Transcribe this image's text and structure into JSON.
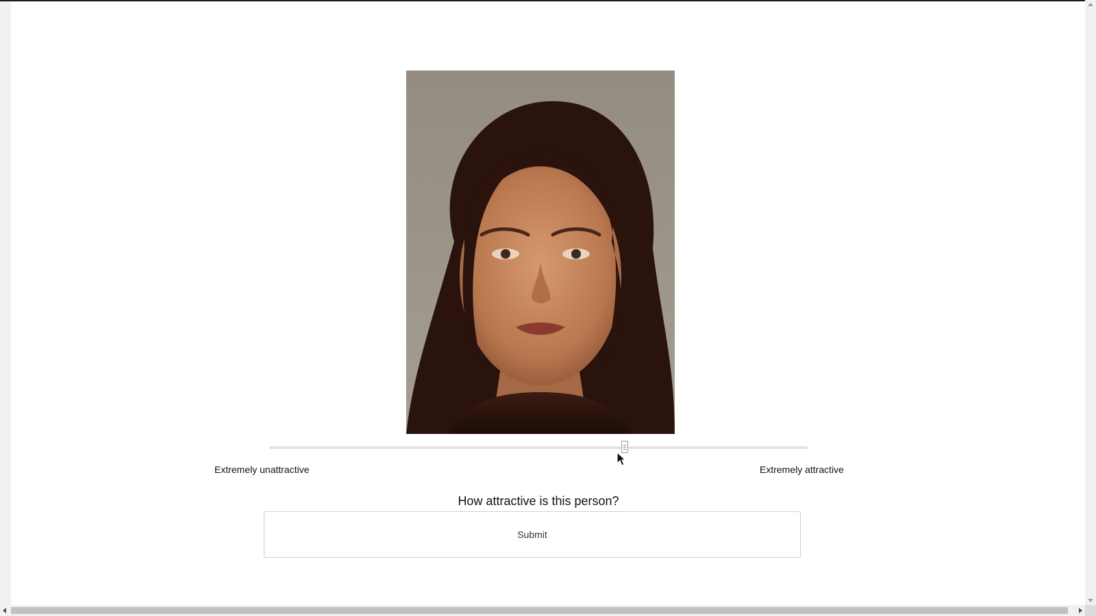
{
  "stimulus": {
    "image_alt": "Face photograph"
  },
  "rating": {
    "value_fraction": 0.66,
    "min_label": "Extremely unattractive",
    "max_label": "Extremely attractive"
  },
  "question": "How attractive is this person?",
  "submit_label": "Submit",
  "colors": {
    "background": "#ffffff",
    "track": "#e6e2e4",
    "photo_backdrop": "#9a9386"
  }
}
